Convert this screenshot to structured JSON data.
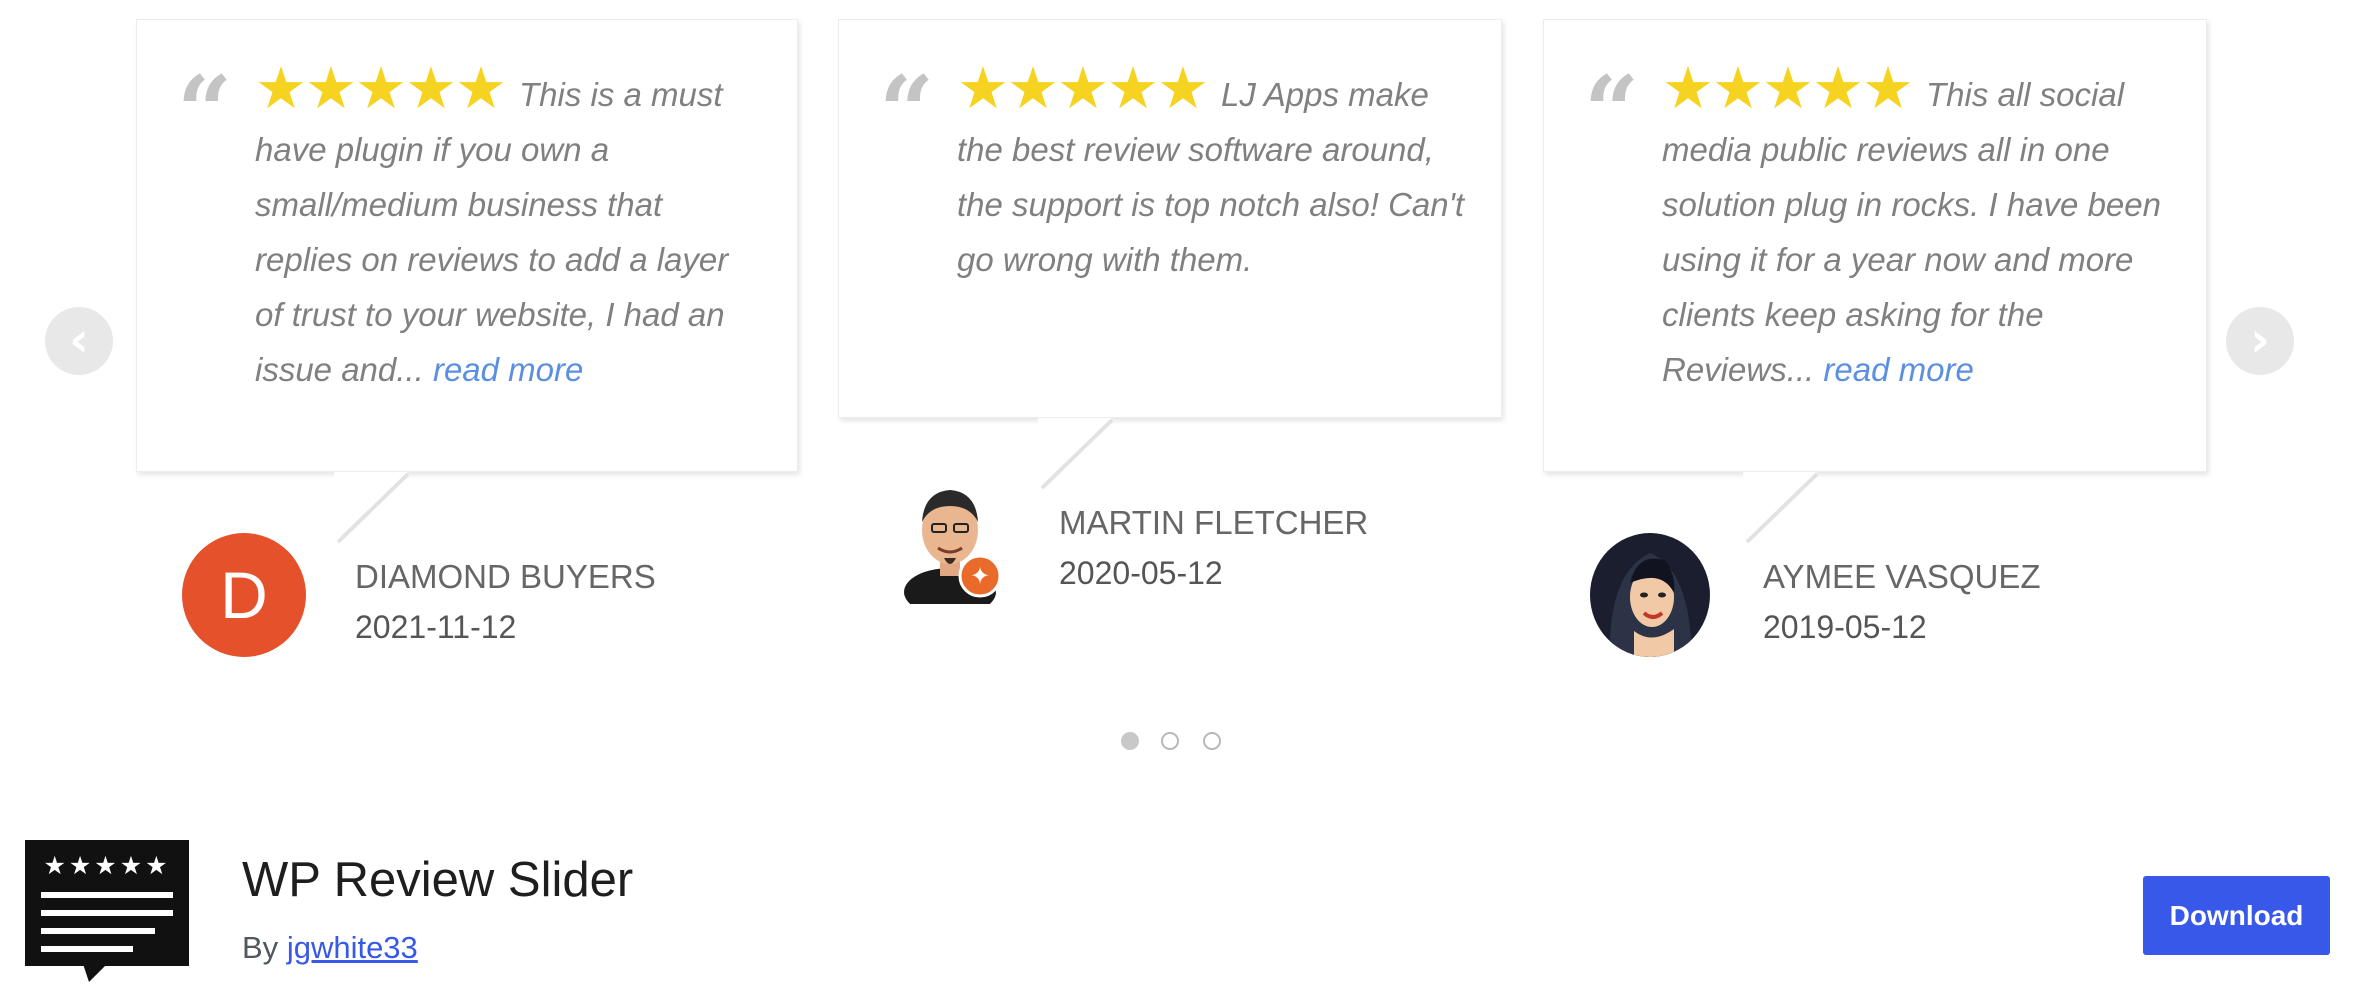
{
  "slider": {
    "reviews": [
      {
        "stars": "★★★★★",
        "text": "This is a must have plugin if you own a small/medium business that replies on reviews to add a layer of trust to your website, I had an issue and...",
        "read_more": "read more",
        "author": "DIAMOND BUYERS",
        "date": "2021-11-12",
        "avatar_letter": "D"
      },
      {
        "stars": "★★★★★",
        "text": "LJ Apps make the best review software around, the support is top notch also! Can't go wrong with them.",
        "read_more": "",
        "author": "MARTIN FLETCHER",
        "date": "2020-05-12"
      },
      {
        "stars": "★★★★★",
        "text": "This all social media public reviews all in one solution plug in rocks. I have been using it for a year now and more clients keep asking for the Reviews...",
        "read_more": "read more",
        "author": "AYMEE VASQUEZ",
        "date": "2019-05-12"
      }
    ],
    "quote_mark": "“",
    "prev_icon": "‹",
    "next_icon": "›",
    "pagination": {
      "count": 3,
      "active": 1
    }
  },
  "plugin": {
    "title": "WP Review Slider",
    "by_label": "By",
    "author": "jgwhite33",
    "icon_stars": "★★★★★",
    "download_label": "Download"
  },
  "colors": {
    "star": "#f5d320",
    "link": "#5b8fe0",
    "avatar_d": "#e4512b",
    "button": "#3858e9"
  }
}
